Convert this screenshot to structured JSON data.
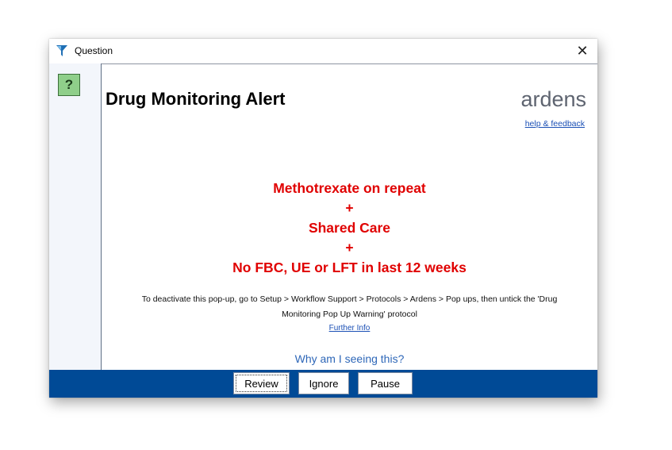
{
  "window": {
    "title": "Question",
    "close_glyph": "✕",
    "app_icon": "funnel-icon"
  },
  "left_pane": {
    "help_button_label": "?",
    "help_icon": "question-mark-icon"
  },
  "content": {
    "heading": "Drug Monitoring Alert",
    "brand": "ardens",
    "help_feedback_link": "help & feedback",
    "alert_lines": [
      "Methotrexate on repeat",
      "+",
      "Shared Care",
      "+",
      "No FBC, UE or LFT in last 12 weeks"
    ],
    "instructions_line1": "To deactivate this pop-up, go to Setup > Workflow Support > Protocols > Ardens > Pop ups, then untick the 'Drug",
    "instructions_line2": "Monitoring Pop Up Warning' protocol",
    "further_info_link": "Further Info",
    "why_link": "Why am I seeing this?"
  },
  "buttons": {
    "review": "Review",
    "ignore": "Ignore",
    "pause": "Pause"
  },
  "colors": {
    "alert_red": "#e00000",
    "bottom_bar": "#004a96",
    "link_blue": "#1a4fb5",
    "help_green": "#8fcf8a"
  }
}
